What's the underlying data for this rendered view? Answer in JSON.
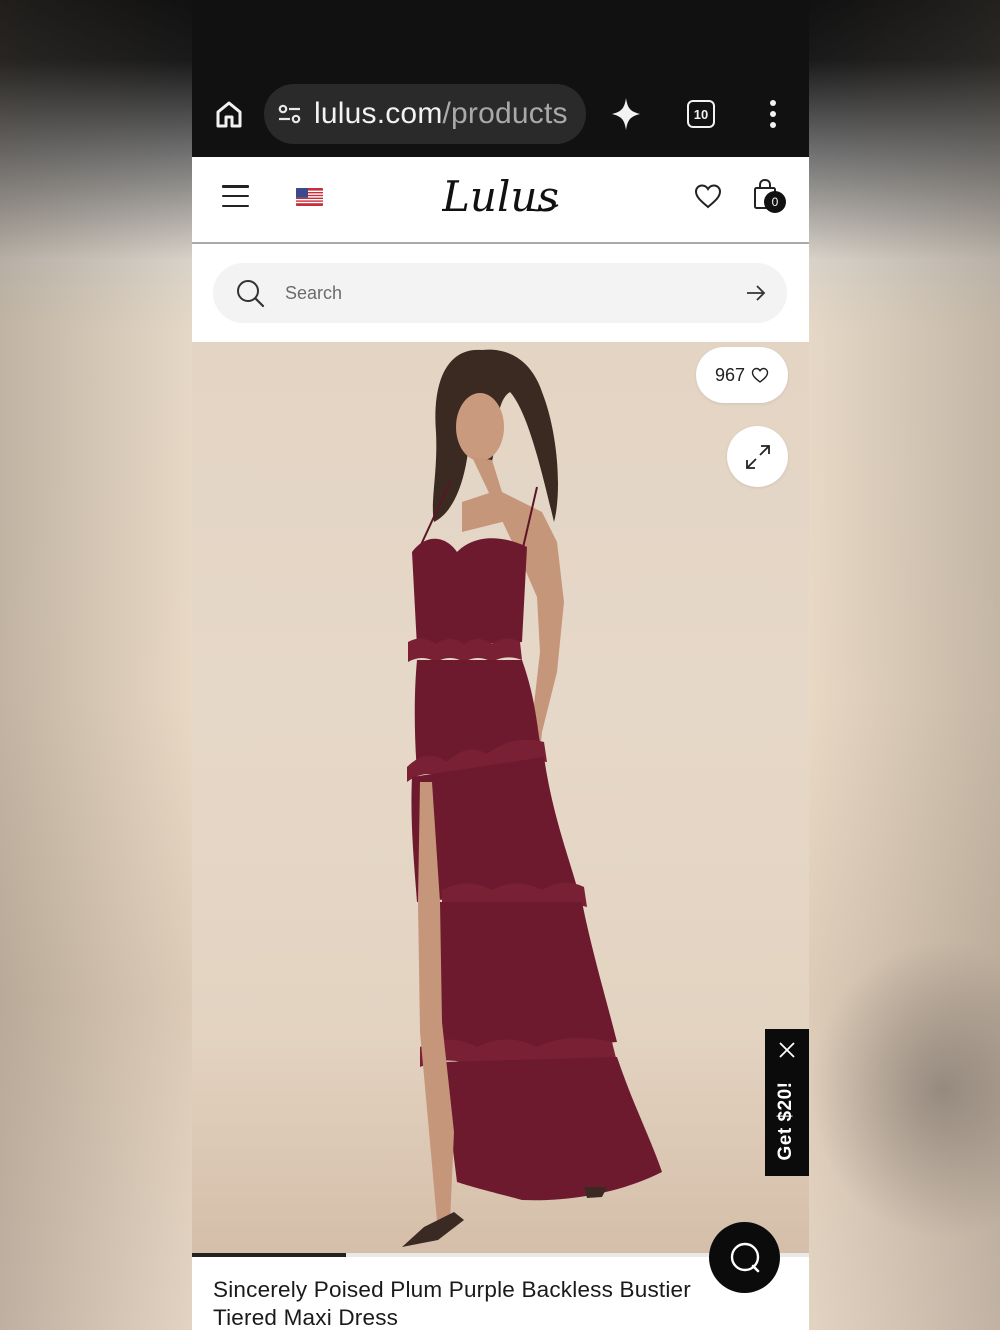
{
  "browser": {
    "url_host": "lulus.com",
    "url_path": "/products",
    "tab_count": "10",
    "icons": [
      "home-icon",
      "site-settings-icon",
      "sparkle-icon",
      "tab-switcher-icon",
      "more-vert-icon"
    ]
  },
  "header": {
    "logo_text": "Lulus",
    "bag_count": "0",
    "icons": [
      "hamburger-menu-icon",
      "us-flag-icon",
      "heart-icon",
      "shopping-bag-icon"
    ]
  },
  "search": {
    "placeholder": "Search",
    "icons": [
      "search-icon",
      "arrow-right-icon"
    ]
  },
  "product": {
    "like_count": "967",
    "promo_label": "Get $20!",
    "image_progress_fraction": 0.25,
    "title": "Sincerely Poised Plum Purple Backless Bustier Tiered Maxi Dress",
    "dress_color": "#6e1a2e",
    "icons": [
      "heart-outline-icon",
      "expand-icon",
      "close-icon",
      "chat-icon"
    ]
  }
}
